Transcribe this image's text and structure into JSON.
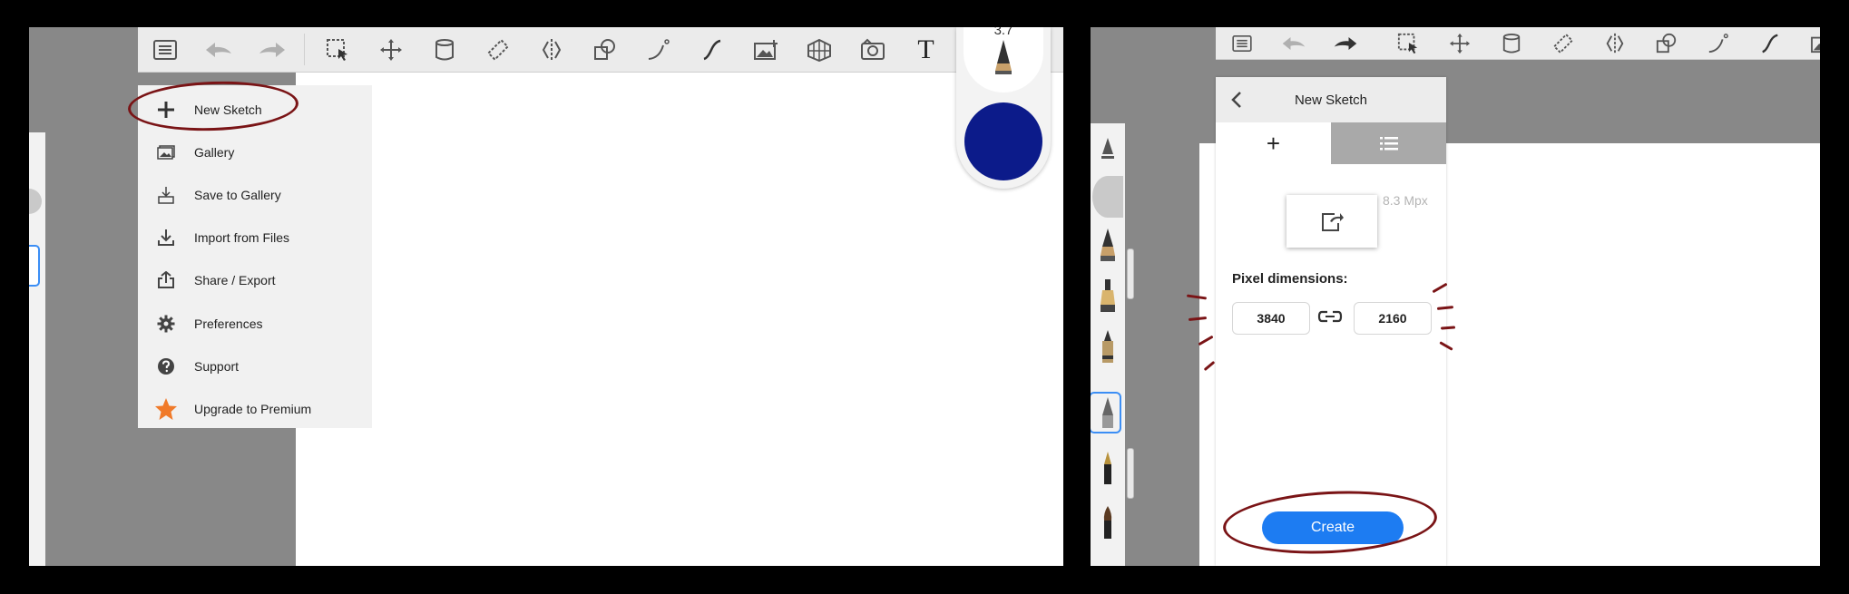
{
  "left": {
    "brush": {
      "size": "3.7"
    },
    "colors": {
      "swatch": "#0c1b8a",
      "annotation": "#7a1416"
    },
    "menu": {
      "items": [
        {
          "label": "New Sketch",
          "icon": "plus-icon"
        },
        {
          "label": "Gallery",
          "icon": "gallery-icon"
        },
        {
          "label": "Save to Gallery",
          "icon": "save-icon"
        },
        {
          "label": "Import from Files",
          "icon": "import-icon"
        },
        {
          "label": "Share / Export",
          "icon": "share-icon"
        },
        {
          "label": "Preferences",
          "icon": "gear-icon"
        },
        {
          "label": "Support",
          "icon": "help-icon"
        },
        {
          "label": "Upgrade to Premium",
          "icon": "star-icon"
        }
      ]
    },
    "toolbar": {
      "text_tool": "T"
    }
  },
  "right": {
    "dialog": {
      "title": "New Sketch",
      "tab_new": "+",
      "megapixels": "8.3 Mpx",
      "pixel_label": "Pixel dimensions:",
      "width": "3840",
      "height": "2160",
      "create_label": "Create"
    },
    "colors": {
      "create_button": "#1d7cf2",
      "annotation": "#7a1416"
    }
  }
}
